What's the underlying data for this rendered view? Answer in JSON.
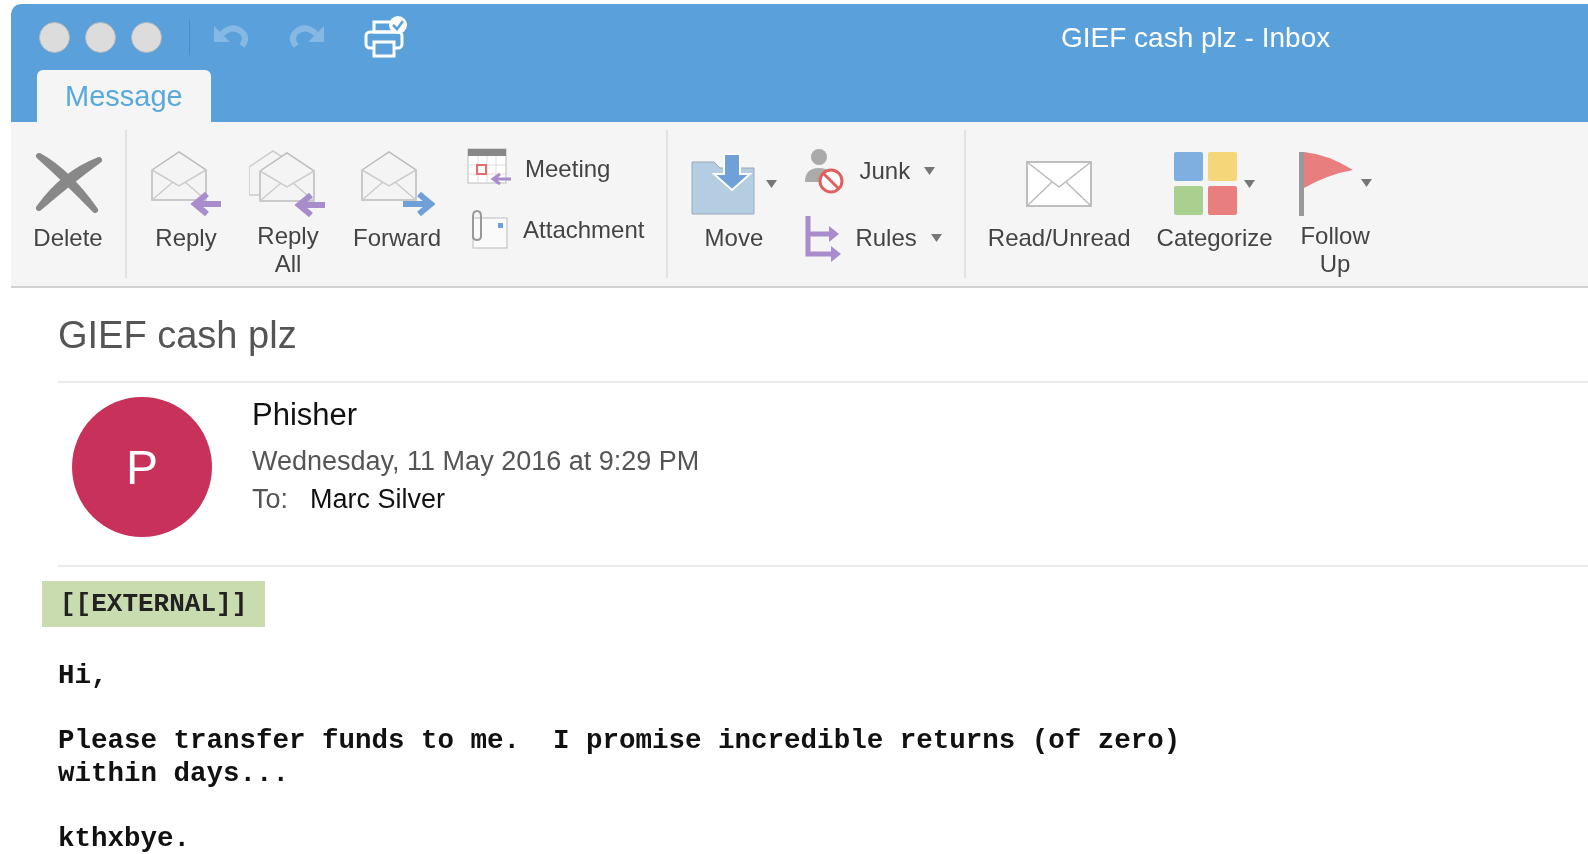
{
  "window": {
    "title": "GIEF cash plz - Inbox"
  },
  "toolbar": [
    {
      "disabled": true
    },
    {
      "disabled": true
    },
    {
      "disabled": false
    }
  ],
  "tabs": [
    {
      "label": "Message",
      "selected": true
    }
  ],
  "ribbon": {
    "groups": [
      {
        "items": [
          {
            "kind": "large",
            "label": "Delete",
            "dropdown": false
          }
        ]
      },
      {
        "items": [
          {
            "kind": "large",
            "label": "Reply",
            "dropdown": false
          },
          {
            "kind": "large",
            "label": "Reply All",
            "dropdown": false
          },
          {
            "kind": "large",
            "label": "Forward",
            "dropdown": false
          },
          {
            "kind": "stack",
            "children": [
              {
                "label": "Meeting",
                "dropdown": false
              },
              {
                "label": "Attachment",
                "dropdown": false
              }
            ]
          }
        ]
      },
      {
        "items": [
          {
            "kind": "large",
            "label": "Move",
            "dropdown": true
          },
          {
            "kind": "stack",
            "children": [
              {
                "label": "Junk",
                "dropdown": true
              },
              {
                "label": "Rules",
                "dropdown": true
              }
            ]
          }
        ]
      },
      {
        "items": [
          {
            "kind": "large",
            "label": "Read/Unread",
            "dropdown": false
          },
          {
            "kind": "large",
            "label": "Categorize",
            "dropdown": true
          },
          {
            "kind": "large",
            "label": "Follow Up",
            "dropdown": true
          }
        ]
      }
    ]
  },
  "message": {
    "subject": "GIEF cash plz",
    "avatar": {
      "initial": "P",
      "color": "#c8325a"
    },
    "sender": "Phisher",
    "date": "Wednesday, 11 May 2016 at 9:29 PM",
    "to_label": "To:",
    "to": "Marc Silver",
    "tag": "[[EXTERNAL]]",
    "body": [
      "Hi,",
      "Please transfer funds to me.  I promise incredible returns (of zero)\nwithin days...",
      "kthxbye."
    ]
  }
}
